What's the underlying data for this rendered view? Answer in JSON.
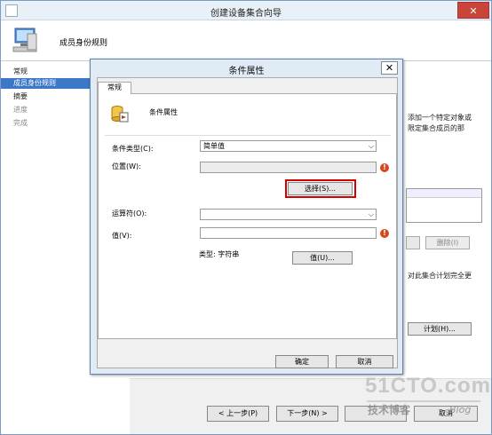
{
  "wizard": {
    "title": "创建设备集合向导",
    "header_title": "成员身份规则",
    "nav": [
      {
        "label": "常规",
        "state": "normal"
      },
      {
        "label": "成员身份规则",
        "state": "active"
      },
      {
        "label": "摘要",
        "state": "normal"
      },
      {
        "label": "进度",
        "state": "disabled"
      },
      {
        "label": "完成",
        "state": "disabled"
      }
    ],
    "background": {
      "text1": "添加一个特定对象或",
      "text2": "限定集合成员的那",
      "delete_label": "删除(I)",
      "text3": "对此集合计划完全更",
      "text4": "",
      "schedule_label": "计划(H)..."
    },
    "buttons": {
      "prev": "< 上一步(P)",
      "next": "下一步(N) >",
      "finish": "",
      "cancel": "取消"
    }
  },
  "dialog": {
    "title": "条件属性",
    "close_glyph": "✕",
    "tab": "常规",
    "section_title": "条件属性",
    "condition_type_label": "条件类型(C):",
    "condition_type_value": "简单值",
    "location_label": "位置(W):",
    "location_value": "",
    "select_button": "选择(S)...",
    "operator_label": "运算符(O):",
    "operator_value": "",
    "value_label": "值(V):",
    "value_value": "",
    "type_info": "类型: 字符串",
    "value_button": "值(U)...",
    "ok_button": "确定",
    "cancel_button": "取消",
    "error_glyph": "!"
  },
  "watermark": {
    "logo": "51CTO.com",
    "sub": "技术博客",
    "blog": "Blog"
  },
  "colors": {
    "nav_active": "#3b78c8",
    "highlight": "#d40000",
    "error": "#d24a1b"
  }
}
